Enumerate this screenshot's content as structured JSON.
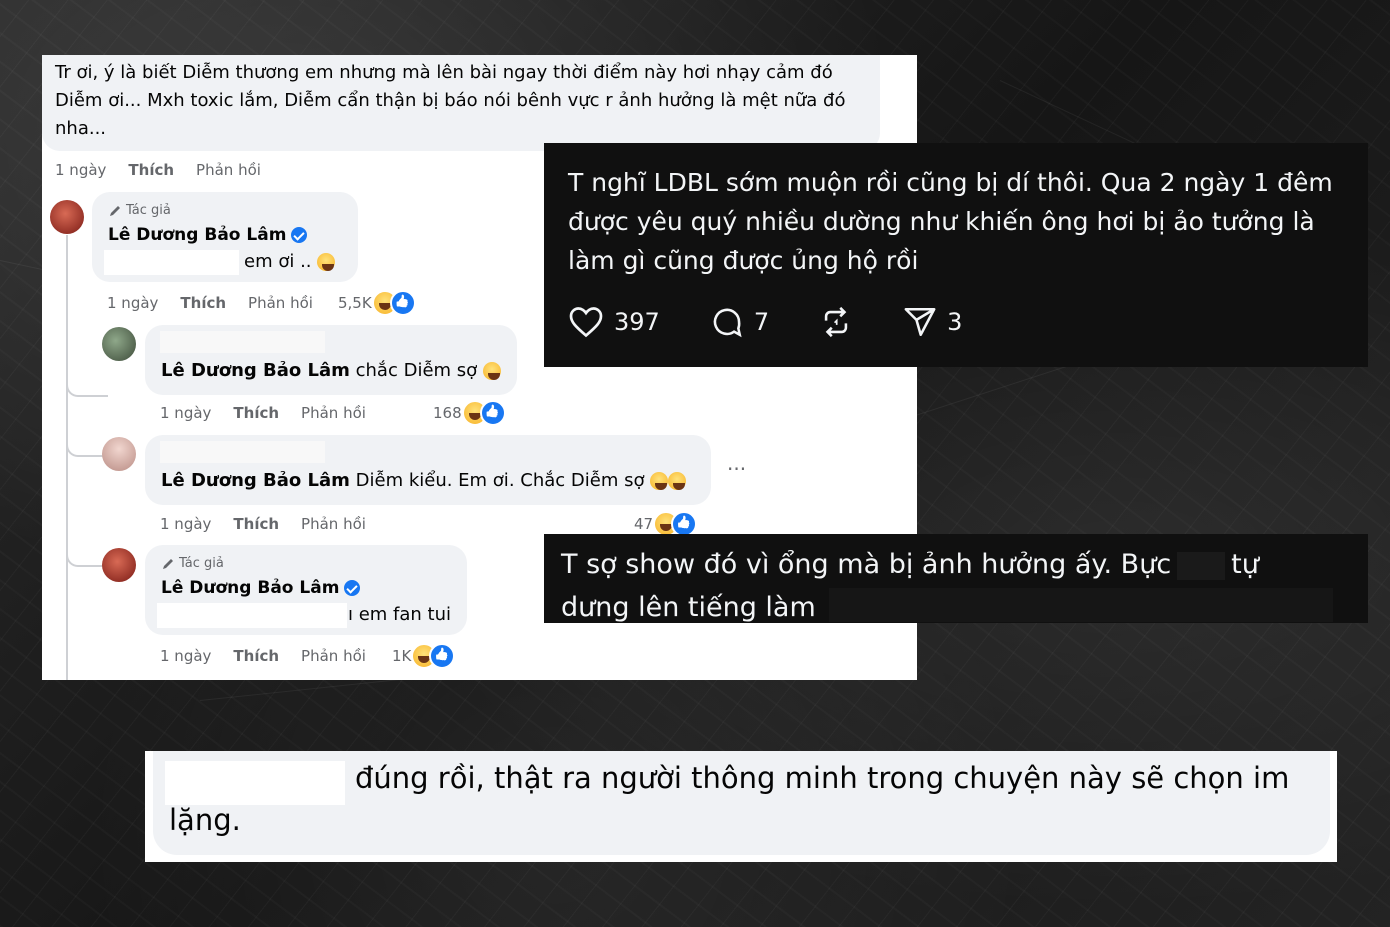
{
  "fb": {
    "top_comment": {
      "text": "Tr ơi, ý là biết Diễm thương em nhưng mà lên bài ngay thời điểm này hơi nhạy cảm đó Diễm ơi... Mxh toxic lắm, Diễm cẩn thận bị báo nói bênh vực r ảnh hưởng là mệt nữa đó nha...",
      "time": "1 ngày",
      "like": "Thích",
      "reply": "Phản hồi"
    },
    "reply1": {
      "author_tag": "Tác giả",
      "name": "Lê Dương Bảo Lâm",
      "text": "em ơi ..",
      "time": "1 ngày",
      "like": "Thích",
      "reply": "Phản hồi",
      "count": "5,5K"
    },
    "reply2": {
      "mention": "Lê Dương Bảo Lâm",
      "text": " chắc Diễm sợ",
      "time": "1 ngày",
      "like": "Thích",
      "reply": "Phản hồi",
      "count": "168"
    },
    "reply3": {
      "mention": "Lê Dương Bảo Lâm",
      "text": " Diễm kiểu. Em ơi. Chắc Diễm sợ",
      "time": "1 ngày",
      "like": "Thích",
      "reply": "Phản hồi",
      "count": "47",
      "more": "···"
    },
    "reply4": {
      "author_tag": "Tác giả",
      "name": "Lê Dương Bảo Lâm",
      "text": "ı em fan tui",
      "time": "1 ngày",
      "like": "Thích",
      "reply": "Phản hồi",
      "count": "1K"
    }
  },
  "threads1": {
    "text": "T nghĩ LDBL sớm muộn rồi cũng bị dí thôi. Qua 2 ngày 1 đêm được yêu quý nhiều dường như khiến ông hơi bị ảo tưởng là làm gì cũng được ủng hộ rồi",
    "likes": "397",
    "comments": "7",
    "shares": "3",
    "icons": [
      "heart-icon",
      "comment-icon",
      "repost-icon",
      "send-icon"
    ]
  },
  "threads2": {
    "line1a": "T sợ show đó vì ổng mà bị ảnh hưởng ấy. Bực",
    "line1b": "tự",
    "line2": "dưng lên tiếng làm"
  },
  "bottom": {
    "text": "đúng rồi, thật ra người thông minh trong chuyện này sẽ chọn im",
    "text2": "lặng."
  },
  "colors": {
    "fb_blue": "#1877f2",
    "bubble": "#f0f2f5",
    "dark": "#101010"
  }
}
